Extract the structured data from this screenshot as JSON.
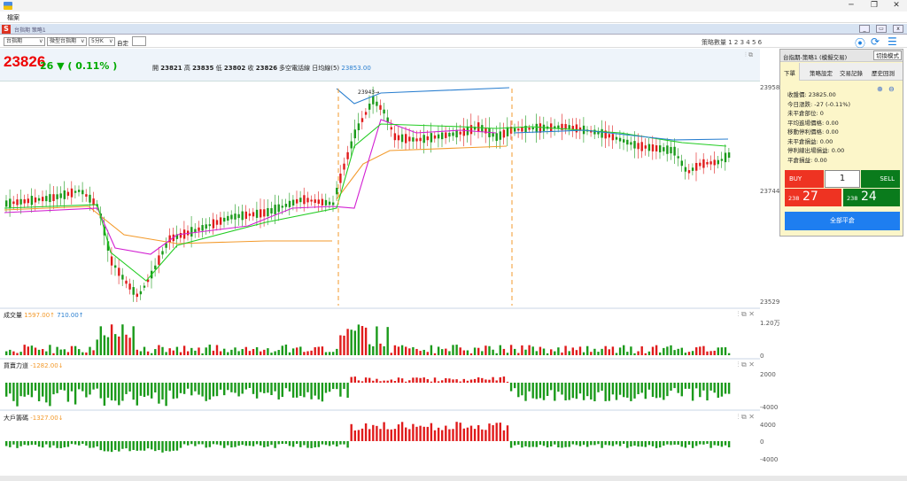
{
  "window": {
    "title": "",
    "menu": "檔案",
    "doc_title": "台指期 策略1",
    "doc_logo": "S"
  },
  "toolbar": {
    "product": "台指期",
    "contract": "微型台指期",
    "interval": "5分K",
    "custom_label": "自定",
    "strategy_count_label": "策略數量 1 2 3 4 5 6"
  },
  "quote": {
    "price": "23826",
    "change": "26 ▼ ( 0.11% )",
    "open_label": "開",
    "open": "23821",
    "high_label": "高",
    "high": "23835",
    "low_label": "低",
    "low": "23802",
    "close_label": "收",
    "close": "23826",
    "ma_label": "多空電話線 日均線(5)",
    "ma_value": "23853.00",
    "annotation_high": "23943→"
  },
  "axis": {
    "price_top": "23958",
    "price_mid": "23744",
    "price_bottom": "23529",
    "vol_top": "1.20万",
    "vol_zero": "0",
    "force_top": "2000",
    "force_bottom": "-4000",
    "big_top": "4000",
    "big_zero": "0",
    "big_bottom": "-4000"
  },
  "volume": {
    "label": "成交量",
    "v1": "1597.00↑",
    "v2": "710.00↑"
  },
  "force": {
    "label": "買賣力道",
    "v1": "-1282.00↓"
  },
  "bigplayer": {
    "label": "大戶籌碼",
    "v1": "-1327.00↓"
  },
  "panel": {
    "title": "台指期-策略1 (模擬交易)",
    "switch": "切換模式",
    "tabs": [
      "下單",
      "策略設定",
      "交易記錄",
      "歷史回測"
    ],
    "info": [
      "收盤價: 23825.00",
      "今日漲跌: -27 (-0.11%)",
      "未平倉部位: 0",
      "平均進場價格: 0.00",
      "移動停利價格: 0.00",
      "未平倉損益: 0.00",
      "停利線出場損益: 0.00",
      "平倉損益: 0.00"
    ],
    "buy_label": "BUY",
    "sell_label": "SELL",
    "qty": "1",
    "bid_prefix": "238",
    "bid_suffix": "27",
    "ask_prefix": "238",
    "ask_suffix": "24",
    "close_all": "全部平倉"
  },
  "colors": {
    "up": "#e01b1b",
    "down": "#1a9a1a",
    "ma_orange": "#f39a2b",
    "ma_magenta": "#d21fd2",
    "ma_green": "#22cc22",
    "line_blue": "#2a7fd0"
  }
}
